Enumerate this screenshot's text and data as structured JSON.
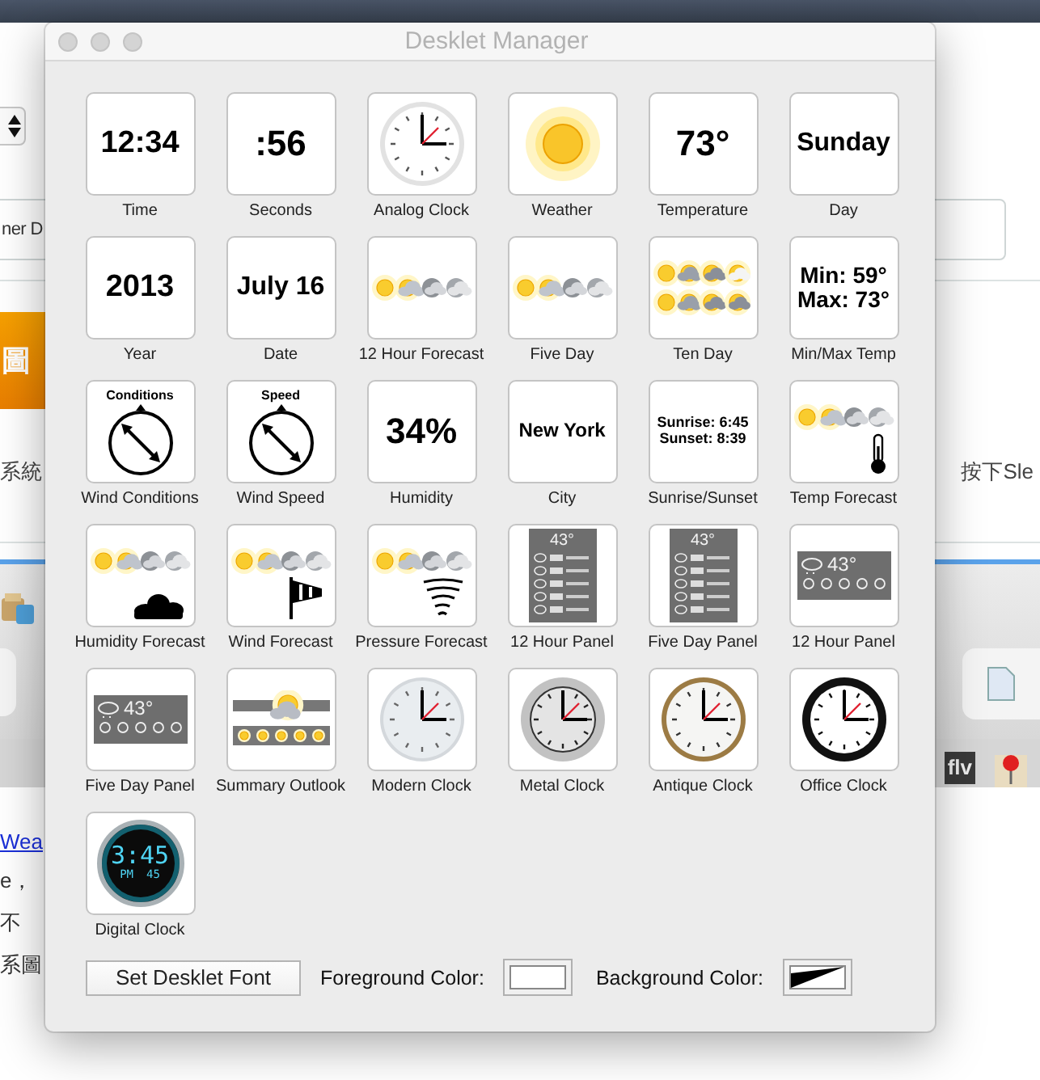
{
  "window": {
    "title": "Desklet Manager"
  },
  "desklets": [
    {
      "label": "Time",
      "kind": "text",
      "lines": [
        "12:34"
      ]
    },
    {
      "label": "Seconds",
      "kind": "text",
      "lines": [
        ":56"
      ]
    },
    {
      "label": "Analog Clock",
      "kind": "classic"
    },
    {
      "label": "Weather",
      "kind": "sun"
    },
    {
      "label": "Temperature",
      "kind": "text",
      "lines": [
        "73°"
      ]
    },
    {
      "label": "Day",
      "kind": "text",
      "lines": [
        "Sunday"
      ]
    },
    {
      "label": "Year",
      "kind": "text",
      "lines": [
        "2013"
      ]
    },
    {
      "label": "Date",
      "kind": "text",
      "lines": [
        "July 16"
      ]
    },
    {
      "label": "12 Hour Forecast",
      "kind": "forecast"
    },
    {
      "label": "Five Day",
      "kind": "forecast"
    },
    {
      "label": "Ten Day",
      "kind": "tenday"
    },
    {
      "label": "Min/Max Temp",
      "kind": "text",
      "lines": [
        "Min: 59°",
        "Max: 73°"
      ]
    },
    {
      "label": "Wind Conditions",
      "kind": "dial",
      "caption": "Conditions"
    },
    {
      "label": "Wind Speed",
      "kind": "dial",
      "caption": "Speed"
    },
    {
      "label": "Humidity",
      "kind": "text",
      "lines": [
        "34%"
      ]
    },
    {
      "label": "City",
      "kind": "text",
      "lines": [
        "New York"
      ]
    },
    {
      "label": "Sunrise/Sunset",
      "kind": "text",
      "lines": [
        "Sunrise: 6:45",
        "Sunset: 8:39"
      ]
    },
    {
      "label": "Temp Forecast",
      "kind": "thermometer"
    },
    {
      "label": "Humidity Forecast",
      "kind": "cloud"
    },
    {
      "label": "Wind Forecast",
      "kind": "windsock"
    },
    {
      "label": "Pressure Forecast",
      "kind": "tornado"
    },
    {
      "label": "12 Hour Panel",
      "kind": "panel",
      "temp": "43°"
    },
    {
      "label": "Five Day Panel",
      "kind": "panel",
      "temp": "43°"
    },
    {
      "label": "12 Hour Panel",
      "kind": "widepanel",
      "temp": "43°"
    },
    {
      "label": "Five Day Panel",
      "kind": "widepanel",
      "temp": "43°"
    },
    {
      "label": "Summary Outlook",
      "kind": "summary"
    },
    {
      "label": "Modern Clock",
      "kind": "modern"
    },
    {
      "label": "Metal Clock",
      "kind": "metal"
    },
    {
      "label": "Antique Clock",
      "kind": "antique"
    },
    {
      "label": "Office Clock",
      "kind": "office"
    },
    {
      "label": "Digital Clock",
      "kind": "digital",
      "time": "3:45",
      "period": "PM",
      "seconds": "45"
    }
  ],
  "footer": {
    "font_button": "Set Desklet Font",
    "foreground_label": "Foreground Color:",
    "background_label": "Background Color:"
  },
  "backdrop": {
    "field_value": "ner D",
    "banner": "圖",
    "left_text": "系統",
    "right_text": "按下Sle",
    "badge": "flv",
    "link": "Wea",
    "lines": [
      "e，",
      "不",
      "系圖"
    ]
  }
}
